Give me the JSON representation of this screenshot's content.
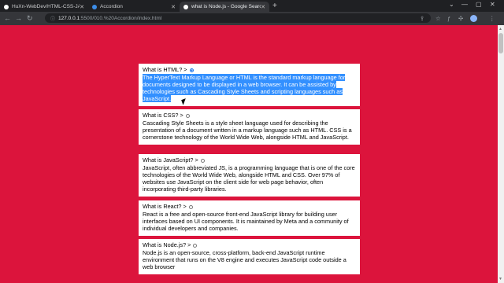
{
  "browser": {
    "tabs": [
      {
        "title": "HuXn-WebDev/HTML-CSS-JAVA",
        "favicon_color": "#ffffff",
        "active": false
      },
      {
        "title": "Accordion",
        "favicon_color": "#3c8ce7",
        "active": false
      },
      {
        "title": "what is Node.js - Google Search",
        "favicon_color": "#ffffff",
        "active": true
      }
    ],
    "new_tab": "+",
    "url_host": "127.0.0.1",
    "url_path": ":5500/010.%20Accordion/index.html"
  },
  "accordion": [
    {
      "question": "What is HTML? >",
      "open": true,
      "answer": "The HyperText Markup Language or HTML is the standard markup language for documents designed to be displayed in a web browser. It can be assisted by technologies such as Cascading Style Sheets and scripting languages such as JavaScript.",
      "selected": true
    },
    {
      "question": "What is CSS? >",
      "open": false,
      "answer": "Cascading Style Sheets is a style sheet language used for describing the presentation of a document written in a markup language such as HTML. CSS is a cornerstone technology of the World Wide Web, alongside HTML and JavaScript."
    },
    {
      "question": "What is JavaScript? >",
      "open": false,
      "answer": "JavaScript, often abbreviated JS, is a programming language that is one of the core technologies of the World Wide Web, alongside HTML and CSS. Over 97% of websites use JavaScript on the client side for web page behavior, often incorporating third-party libraries."
    },
    {
      "question": "What is React? >",
      "open": false,
      "answer": "React is a free and open-source front-end JavaScript library for building user interfaces based on UI components. It is maintained by Meta and a community of individual developers and companies."
    },
    {
      "question": "What is Node.js? >",
      "open": false,
      "answer": "Node.js is an open-source, cross-platform, back-end JavaScript runtime environment that runs on the V8 engine and executes JavaScript code outside a web browser"
    }
  ]
}
